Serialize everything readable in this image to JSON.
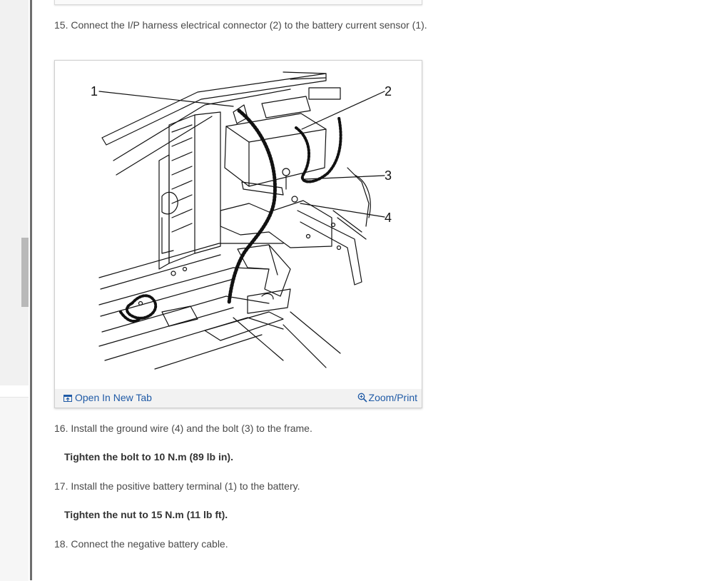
{
  "steps": {
    "s15": "15. Connect the I/P harness electrical connector (2) to the battery current sensor (1).",
    "s16": "16. Install the ground wire (4) and the bolt (3) to the frame.",
    "s16_note": "Tighten the bolt to 10 N.m (89 lb in).",
    "s17": "17. Install the positive battery terminal (1) to the battery.",
    "s17_note": "Tighten the nut to 15 N.m (11 lb ft).",
    "s18": "18. Connect the negative battery cable."
  },
  "figure": {
    "callouts": [
      "1",
      "2",
      "3",
      "4"
    ],
    "open_label": "Open In New Tab",
    "zoom_label": "Zoom/Print",
    "open_icon": "open-new-tab-icon",
    "zoom_icon": "zoom-in-icon"
  },
  "colors": {
    "link": "#1f5aa6",
    "text": "#4a4a4a",
    "bar": "#f2f2f2"
  }
}
